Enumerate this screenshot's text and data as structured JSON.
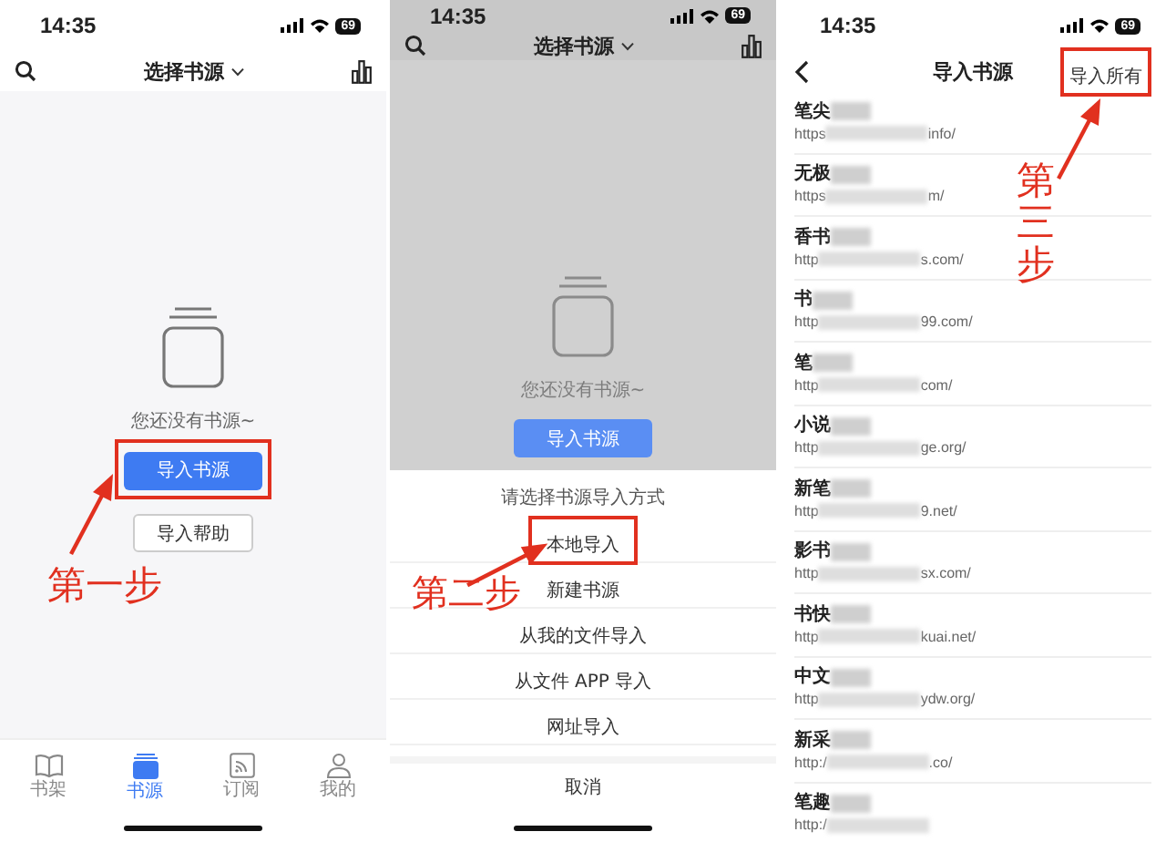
{
  "panels": [
    {
      "kind": "empty_state",
      "dimmed": false,
      "status_bar": {
        "time": "14:35",
        "battery": "69"
      },
      "header": {
        "title": "选择书源"
      },
      "empty": {
        "message": "您还没有书源~",
        "buttons": [
          {
            "label": "导入书源",
            "primary": true,
            "highlighted": true
          },
          {
            "label": "导入帮助",
            "primary": false,
            "highlighted": false
          }
        ]
      },
      "tab_bar": [
        {
          "label": "书架",
          "selected": false
        },
        {
          "label": "书源",
          "selected": true
        },
        {
          "label": "订阅",
          "selected": false
        },
        {
          "label": "我的",
          "selected": false
        }
      ],
      "annotation": {
        "text": "第一步",
        "vertical": false
      }
    },
    {
      "kind": "import_sheet",
      "dimmed": true,
      "status_bar": {
        "time": "14:35",
        "battery": "69"
      },
      "header": {
        "title": "选择书源"
      },
      "empty": {
        "message": "您还没有书源~",
        "buttons": [
          {
            "label": "导入书源",
            "primary": true,
            "highlighted": false
          }
        ]
      },
      "sheet": {
        "title": "请选择书源导入方式",
        "options": [
          {
            "label": "本地导入",
            "highlighted": true
          },
          {
            "label": "新建书源",
            "highlighted": false
          },
          {
            "label": "从我的文件导入",
            "highlighted": false
          },
          {
            "label": "从文件 APP 导入",
            "highlighted": false
          },
          {
            "label": "网址导入",
            "highlighted": false
          }
        ],
        "cancel": "取消"
      },
      "annotation": {
        "text": "第二步",
        "vertical": false
      }
    },
    {
      "kind": "source_list",
      "status_bar": {
        "time": "14:35",
        "battery": "69"
      },
      "header": {
        "title": "导入书源",
        "action": "导入所有",
        "action_highlighted": true
      },
      "sources": [
        {
          "name": "笔尖",
          "url_start": "https",
          "url_end": "info/"
        },
        {
          "name": "无极",
          "url_start": "https",
          "url_end": "m/"
        },
        {
          "name": "香书",
          "url_start": "http",
          "url_end": "s.com/"
        },
        {
          "name": "书",
          "url_start": "http",
          "url_end": "99.com/"
        },
        {
          "name": "笔",
          "url_start": "http",
          "url_end": "com/"
        },
        {
          "name": "小说",
          "url_start": "http",
          "url_end": "ge.org/"
        },
        {
          "name": "新笔",
          "url_start": "http",
          "url_end": "9.net/"
        },
        {
          "name": "影书",
          "url_start": "http",
          "url_end": "sx.com/"
        },
        {
          "name": "书快",
          "url_start": "http",
          "url_end": "kuai.net/"
        },
        {
          "name": "中文",
          "url_start": "http",
          "url_end": "ydw.org/"
        },
        {
          "name": "新采",
          "url_start": "http:/",
          "url_end": ".co/"
        },
        {
          "name": "笔趣",
          "url_start": "http:/"
        }
      ],
      "annotation": {
        "text": "第三步",
        "vertical": true
      }
    }
  ]
}
